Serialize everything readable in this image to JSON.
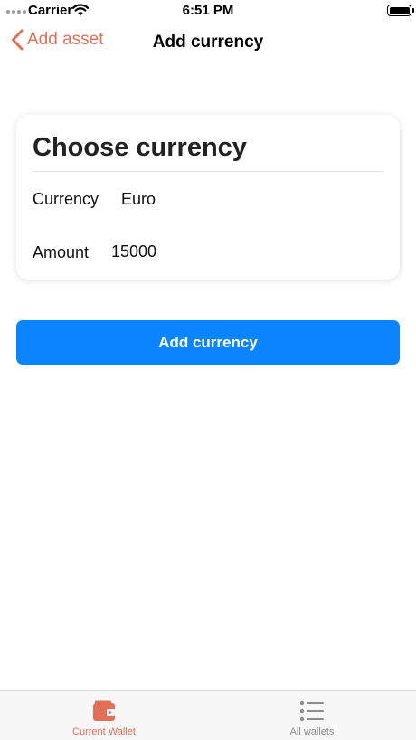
{
  "status_bar": {
    "carrier": "Carrier",
    "time": "6:51 PM"
  },
  "nav": {
    "back_label": "Add asset",
    "title": "Add currency"
  },
  "card": {
    "title": "Choose currency",
    "currency_label": "Currency",
    "currency_value": "Euro",
    "amount_label": "Amount",
    "amount_value": "15000"
  },
  "primary_button": {
    "label": "Add currency"
  },
  "tab_bar": {
    "tabs": [
      {
        "label": "Current Wallet",
        "icon": "wallet-icon",
        "selected": true
      },
      {
        "label": "All wallets",
        "icon": "list-icon",
        "selected": false
      }
    ]
  },
  "colors": {
    "accent": "#e46f58",
    "primary_button": "#0a84ff",
    "tab_inactive": "#8e8e8e"
  }
}
